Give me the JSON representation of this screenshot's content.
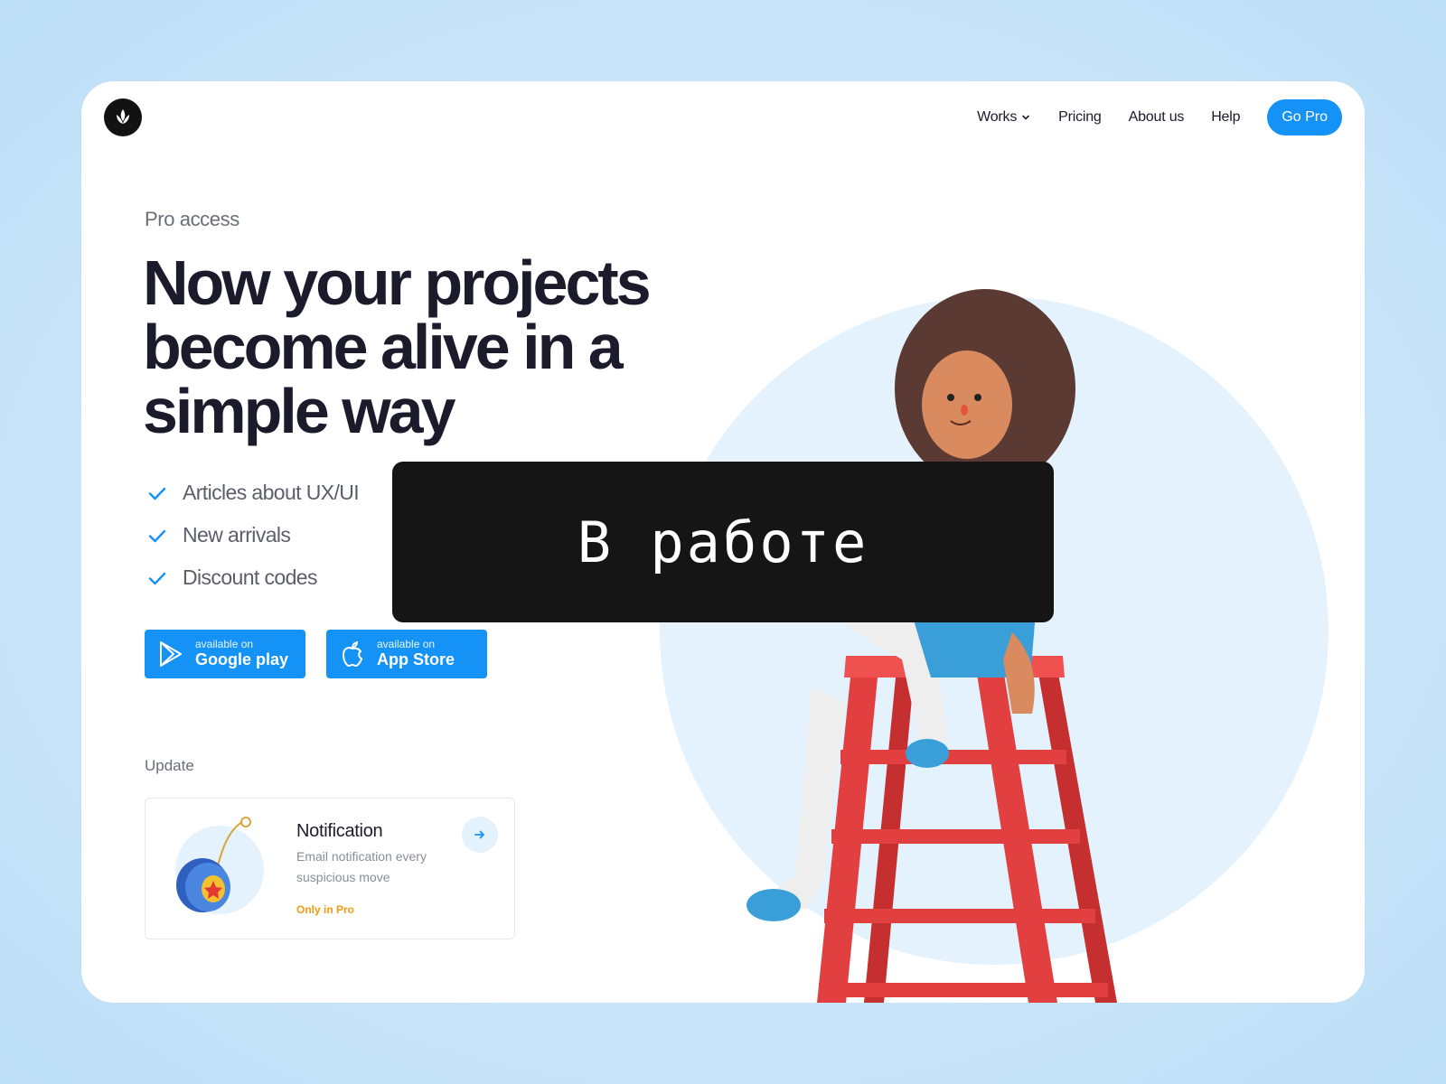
{
  "nav": {
    "items": [
      {
        "label": "Works",
        "has_dropdown": true
      },
      {
        "label": "Pricing"
      },
      {
        "label": "About us"
      },
      {
        "label": "Help"
      }
    ],
    "cta": "Go Pro",
    "accent": "#1592f5"
  },
  "hero": {
    "eyebrow": "Pro access",
    "headline": "Now your projects become alive in a simple way",
    "features": [
      "Articles about UX/UI",
      "New arrivals",
      "Discount codes"
    ]
  },
  "stores": {
    "google": {
      "small": "available on",
      "big": "Google play",
      "icon": "google-play-icon"
    },
    "apple": {
      "small": "available on",
      "big": "App Store",
      "icon": "apple-icon"
    }
  },
  "update": {
    "label": "Update",
    "card": {
      "title": "Notification",
      "description": "Email notification every suspicious move",
      "badge": "Only in Pro",
      "badge_color": "#f39a12",
      "image": "yoyo-icon"
    }
  },
  "overlay": {
    "text": "В работе"
  }
}
